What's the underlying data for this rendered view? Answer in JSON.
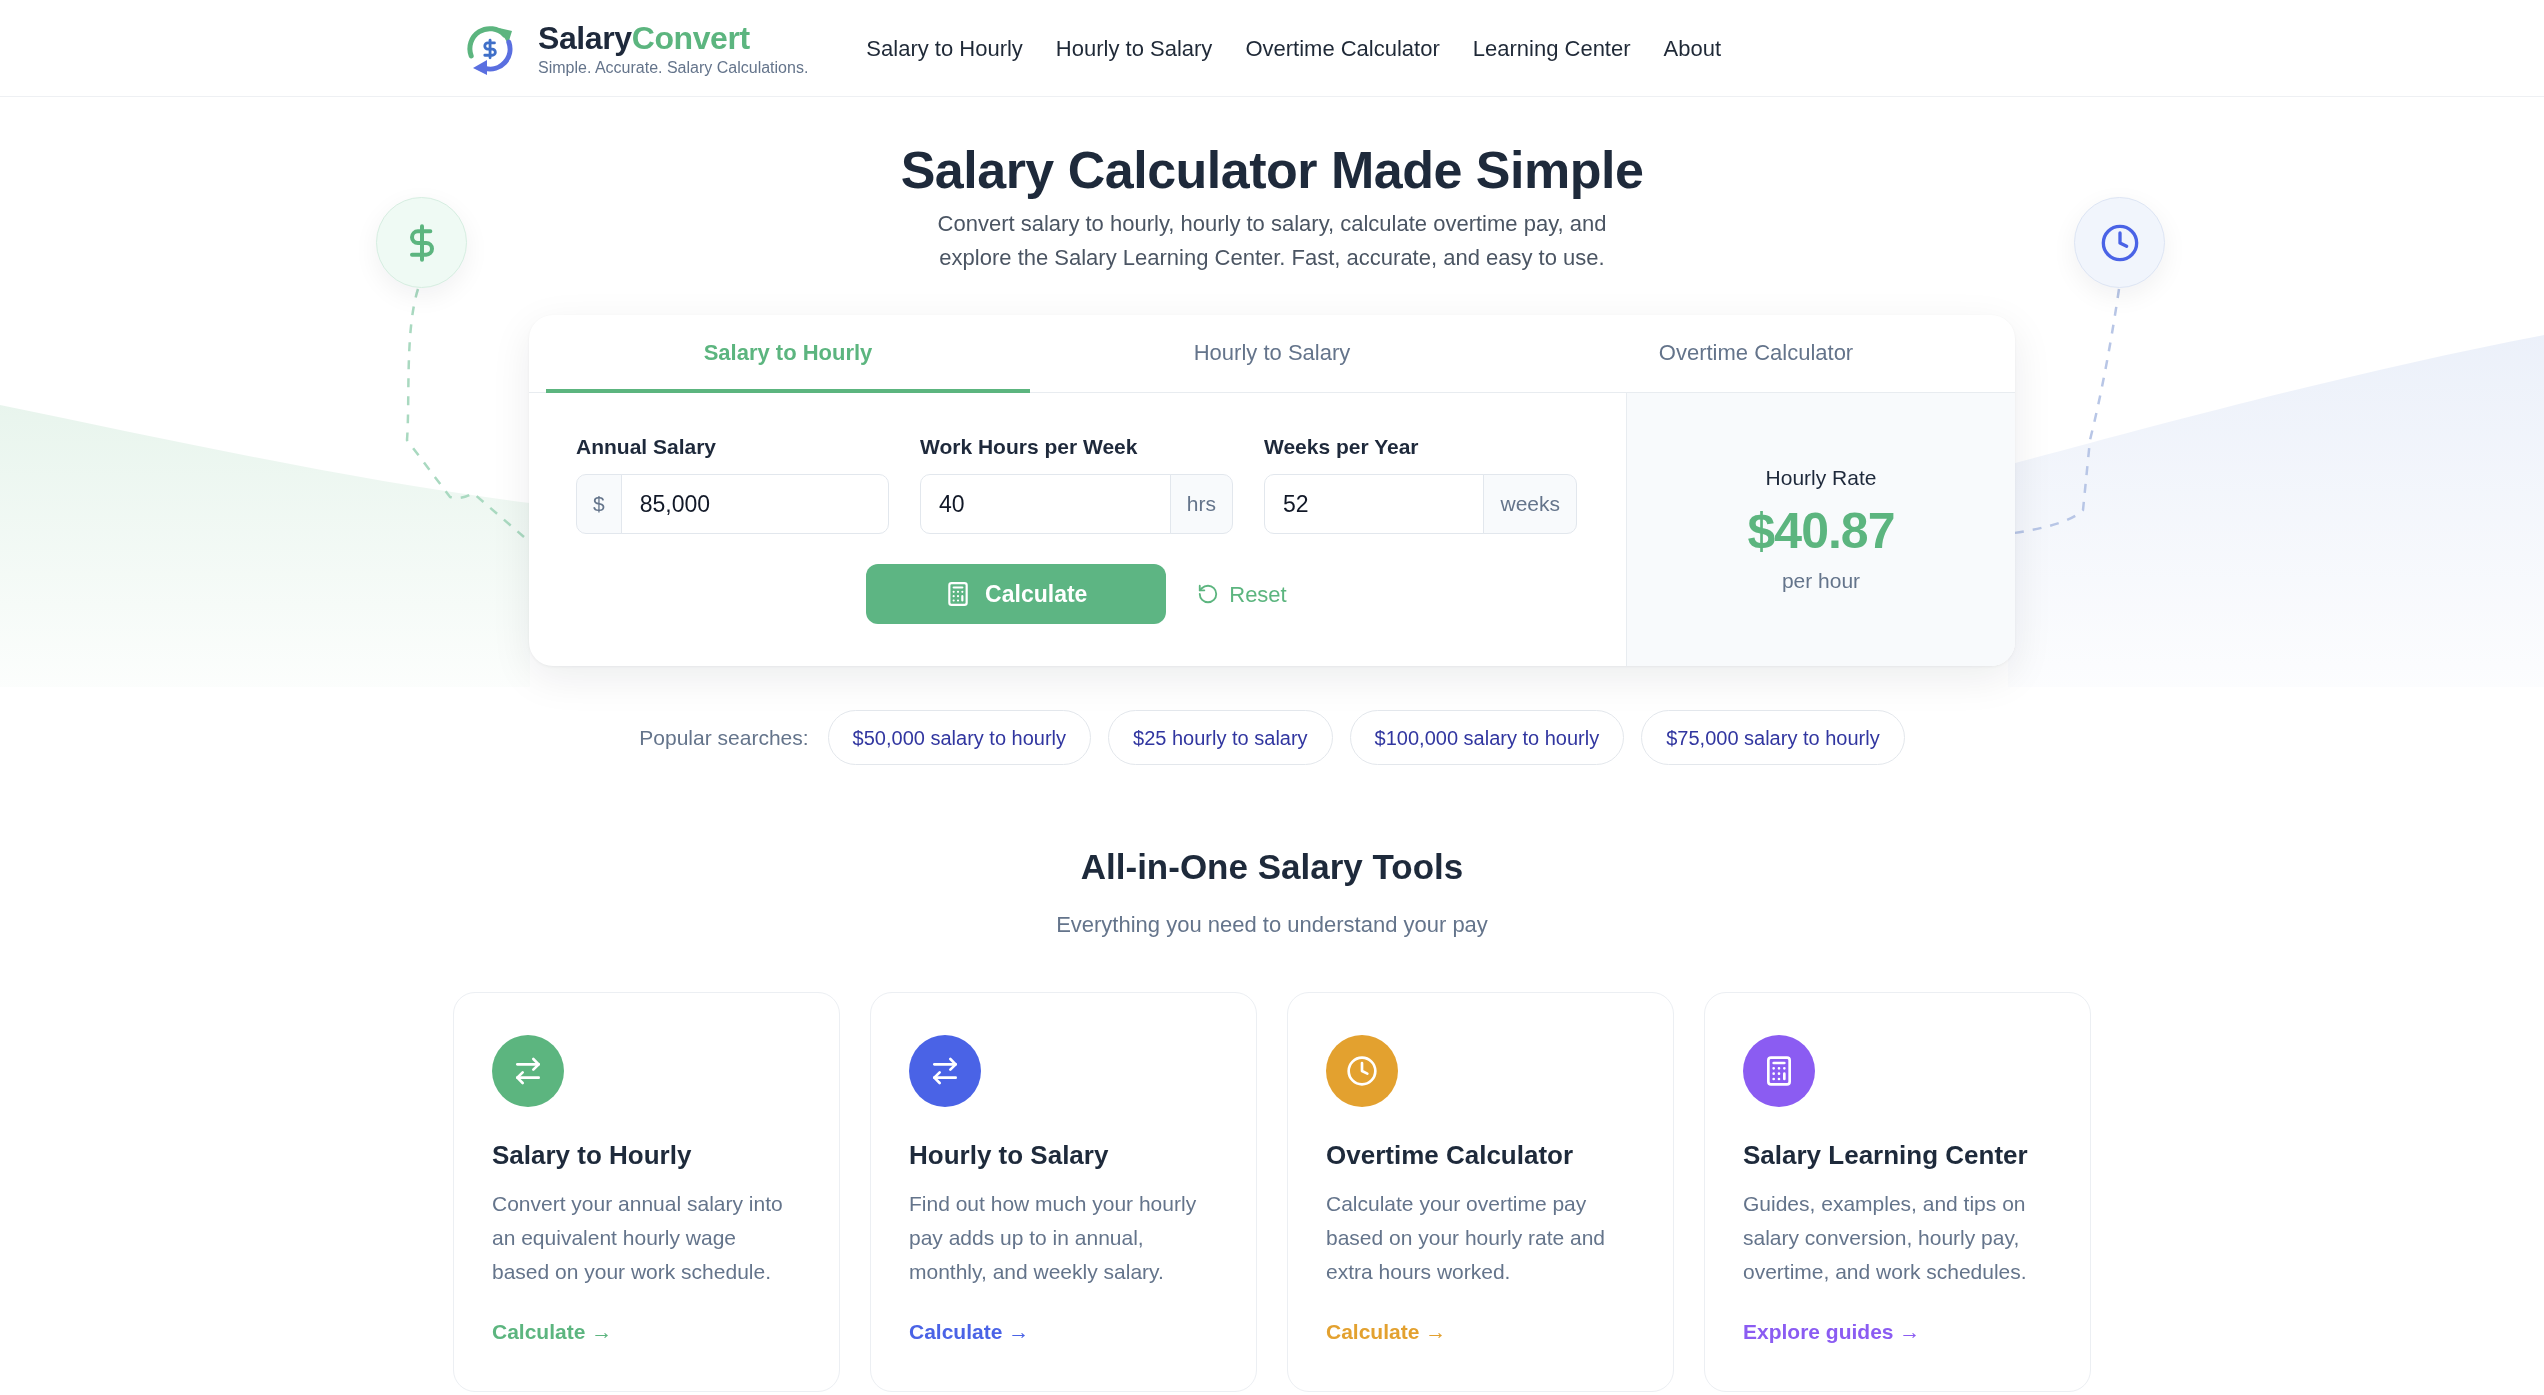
{
  "header": {
    "brand": {
      "name_start": "Salary",
      "name_accent": "Convert",
      "tagline": "Simple. Accurate. Salary Calculations."
    },
    "nav": [
      "Salary to Hourly",
      "Hourly to Salary",
      "Overtime Calculator",
      "Learning Center",
      "About"
    ]
  },
  "hero": {
    "title": "Salary Calculator Made Simple",
    "subtitle": "Convert salary to hourly, hourly to salary, calculate overtime pay, and explore the Salary Learning Center. Fast, accurate, and easy to use."
  },
  "calculator": {
    "tabs": [
      {
        "label": "Salary to Hourly",
        "selected": true
      },
      {
        "label": "Hourly to Salary",
        "selected": false
      },
      {
        "label": "Overtime Calculator",
        "selected": false
      }
    ],
    "fields": [
      {
        "label": "Annual Salary",
        "prefix": "$",
        "value": "85,000"
      },
      {
        "label": "Work Hours per Week",
        "value": "40",
        "suffix": "hrs"
      },
      {
        "label": "Weeks per Year",
        "value": "52",
        "suffix": "weeks"
      }
    ],
    "calculate_button": "Calculate",
    "reset_button": "Reset",
    "result": {
      "label": "Hourly Rate",
      "value": "$40.87",
      "unit": "per hour"
    }
  },
  "popular_searches": {
    "label": "Popular searches:",
    "links": [
      "$50,000 salary to hourly",
      "$25 hourly to salary",
      "$100,000 salary to hourly",
      "$75,000 salary to hourly"
    ]
  },
  "tools": {
    "title": "All-in-One Salary Tools",
    "subtitle": "Everything you need to understand your pay",
    "cards": [
      {
        "title": "Salary to Hourly",
        "description": "Convert your annual salary into an equivalent hourly wage based on your work schedule.",
        "link": "Calculate →",
        "color": "#5cb57f"
      },
      {
        "title": "Hourly to Salary",
        "description": "Find out how much your hourly pay adds up to in annual, monthly, and weekly salary.",
        "link": "Calculate →",
        "color": "#4a63e6"
      },
      {
        "title": "Overtime Calculator",
        "description": "Calculate your overtime pay based on your hourly rate and extra hours worked.",
        "link": "Calculate →",
        "color": "#e3a12f"
      },
      {
        "title": "Salary Learning Center",
        "description": "Guides, examples, and tips on salary conversion, hourly pay, overtime, and work schedules.",
        "link": "Explore guides →",
        "color": "#8b5cf2"
      }
    ]
  }
}
